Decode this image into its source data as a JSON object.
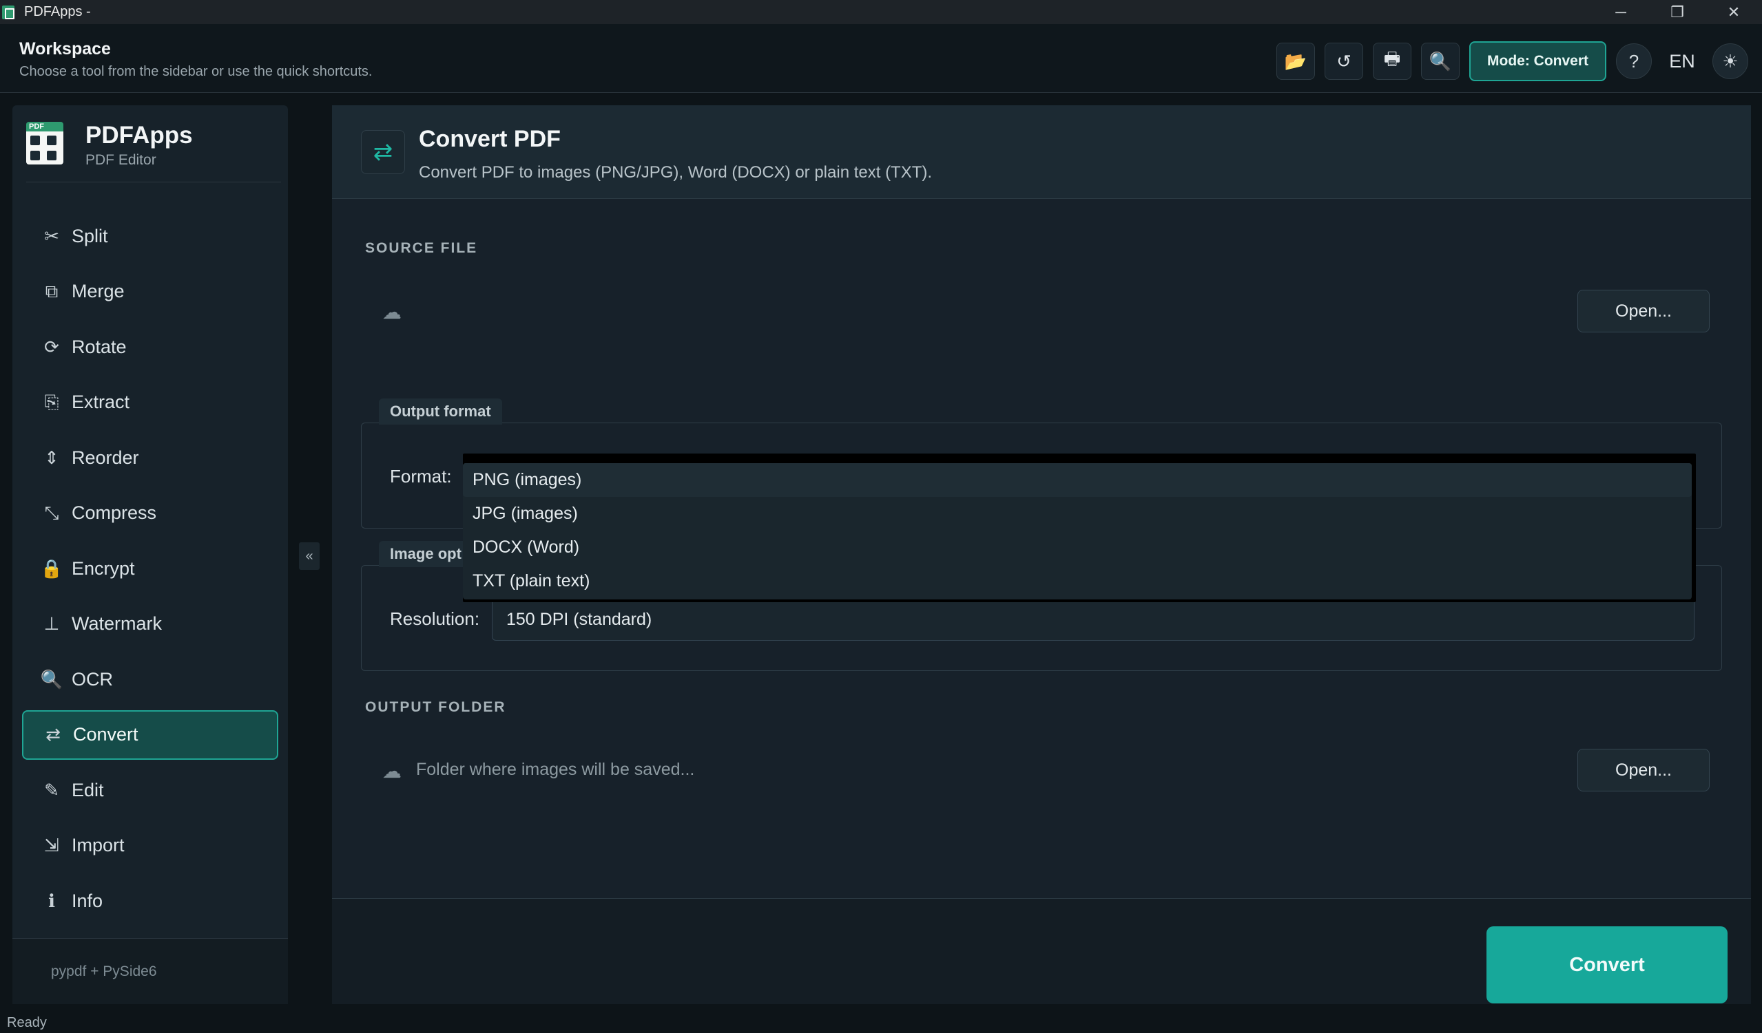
{
  "window": {
    "title": "PDFApps -",
    "minimize": "─",
    "maximize": "❐",
    "close": "✕"
  },
  "header": {
    "title": "Workspace",
    "subtitle": "Choose a tool from the sidebar or use the quick shortcuts.",
    "tools": [
      {
        "icon": "folder-open-icon",
        "glyph": "📂"
      },
      {
        "icon": "history-icon",
        "glyph": "↺"
      },
      {
        "icon": "print-icon",
        "glyph": "🖶"
      },
      {
        "icon": "search-icon",
        "glyph": "🔍"
      }
    ],
    "mode_label": "Mode: Convert",
    "help_label": "?",
    "language": "EN",
    "theme_glyph": "☀"
  },
  "sidebar": {
    "brand_name": "PDFApps",
    "brand_sub": "PDF Editor",
    "logo_text": "PDF",
    "items": [
      {
        "label": "Split",
        "icon": "scissors-icon",
        "glyph": "✂"
      },
      {
        "label": "Merge",
        "icon": "merge-icon",
        "glyph": "⧉"
      },
      {
        "label": "Rotate",
        "icon": "rotate-icon",
        "glyph": "⟳"
      },
      {
        "label": "Extract",
        "icon": "extract-icon",
        "glyph": "⎘"
      },
      {
        "label": "Reorder",
        "icon": "reorder-icon",
        "glyph": "⇕"
      },
      {
        "label": "Compress",
        "icon": "compress-icon",
        "glyph": "⤡"
      },
      {
        "label": "Encrypt",
        "icon": "lock-icon",
        "glyph": "🔒"
      },
      {
        "label": "Watermark",
        "icon": "stamp-icon",
        "glyph": "⊥"
      },
      {
        "label": "OCR",
        "icon": "magnifier-icon",
        "glyph": "🔍"
      },
      {
        "label": "Convert",
        "icon": "swap-icon",
        "glyph": "⇄",
        "active": true
      },
      {
        "label": "Edit",
        "icon": "edit-icon",
        "glyph": "✎"
      },
      {
        "label": "Import",
        "icon": "import-icon",
        "glyph": "⇲"
      },
      {
        "label": "Info",
        "icon": "info-icon",
        "glyph": "ℹ"
      }
    ],
    "footer": "pypdf  +  PySide6",
    "collapse_glyph": "«"
  },
  "panel": {
    "icon_glyph": "⇄",
    "title": "Convert PDF",
    "subtitle": "Convert PDF to images (PNG/JPG), Word (DOCX) or plain text (TXT).",
    "source_label": "SOURCE FILE",
    "source_placeholder": "",
    "open_label": "Open...",
    "output_format_group": "Output format",
    "format_label": "Format:",
    "format_options": [
      "PNG (images)",
      "JPG (images)",
      "DOCX (Word)",
      "TXT (plain text)"
    ],
    "image_options_group": "Image opt",
    "resolution_label": "Resolution:",
    "resolution_value": "150 DPI (standard)",
    "output_folder_label": "OUTPUT FOLDER",
    "folder_placeholder": "Folder where images will be saved...",
    "convert_label": "Convert"
  },
  "status": "Ready",
  "colors": {
    "accent": "#1fa594",
    "primary_button": "#17a89a",
    "background": "#0d1418"
  }
}
